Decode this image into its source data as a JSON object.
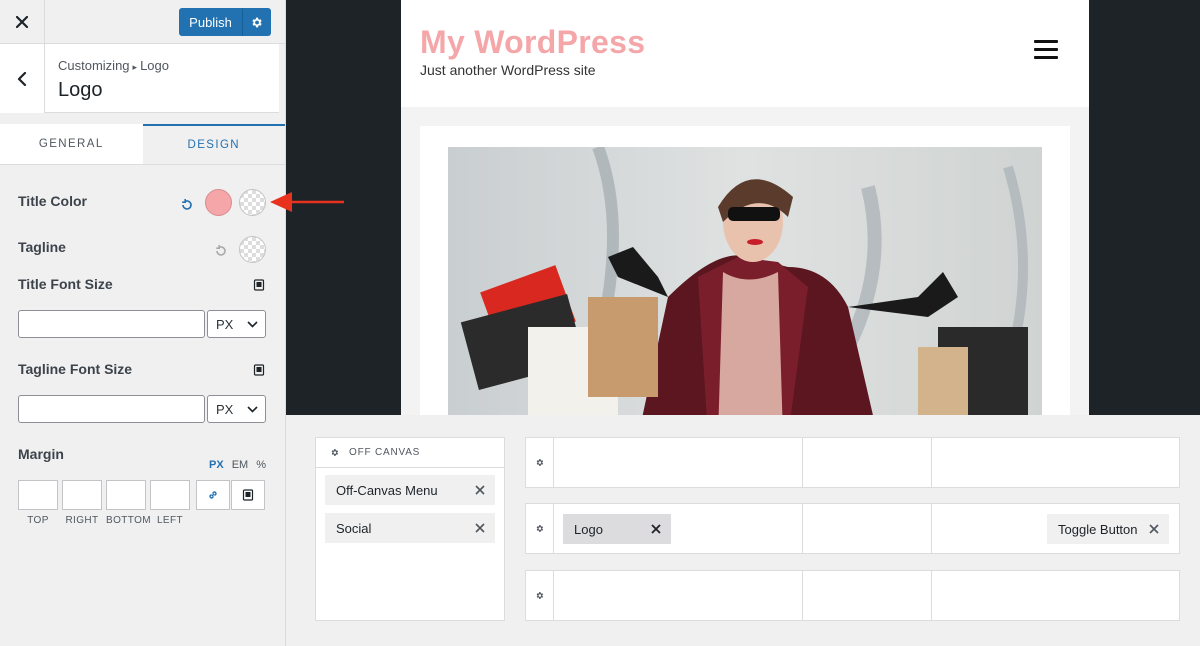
{
  "topbar": {
    "publish_label": "Publish"
  },
  "section": {
    "breadcrumb_parent": "Customizing",
    "breadcrumb_current": "Logo",
    "title": "Logo"
  },
  "tabs": {
    "general": "GENERAL",
    "design": "DESIGN"
  },
  "design": {
    "title_color_label": "Title Color",
    "title_color_value": "#f4a6a9",
    "tagline_label": "Tagline",
    "title_font_size_label": "Title Font Size",
    "title_font_size_value": "",
    "title_font_size_unit": "PX",
    "tagline_font_size_label": "Tagline Font Size",
    "tagline_font_size_value": "",
    "tagline_font_size_unit": "PX",
    "margin_label": "Margin",
    "margin_units": [
      "PX",
      "EM",
      "%"
    ],
    "margin_active_unit": "PX",
    "margin_sides": [
      "TOP",
      "RIGHT",
      "BOTTOM",
      "LEFT"
    ]
  },
  "preview": {
    "site_title": "My WordPress",
    "site_tagline": "Just another WordPress site"
  },
  "builder": {
    "offcanvas_title": "OFF CANVAS",
    "offcanvas_items": [
      "Off-Canvas Menu",
      "Social"
    ],
    "main_row_items": {
      "logo": "Logo",
      "toggle": "Toggle Button"
    }
  },
  "colors": {
    "accent": "#2271b1",
    "title_pink": "#f4a6a9",
    "annotation_red": "#e8321e",
    "preview_bg": "#1d2327"
  }
}
